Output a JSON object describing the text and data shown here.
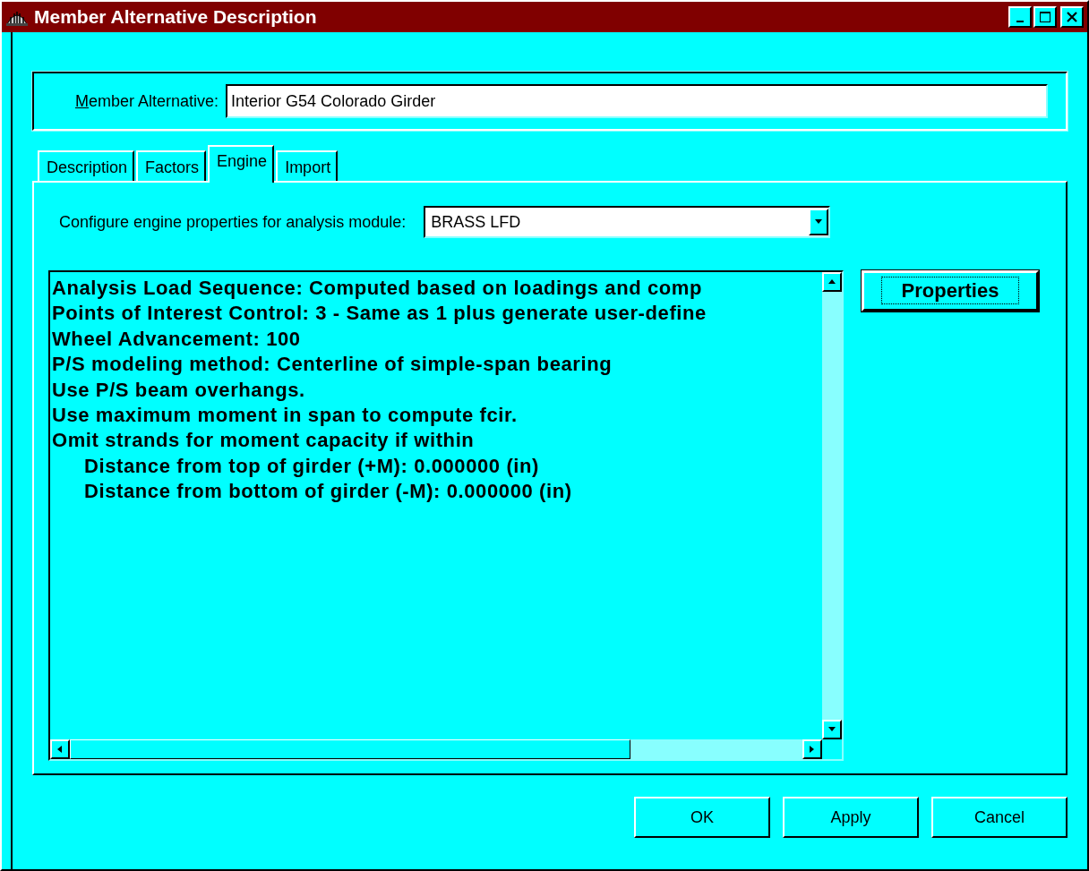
{
  "window": {
    "title": "Member Alternative Description"
  },
  "member_alternative": {
    "label": "Member Alternative:",
    "value": "Interior G54 Colorado Girder"
  },
  "tabs": [
    {
      "label": "Description",
      "selected": false
    },
    {
      "label": "Factors",
      "selected": false
    },
    {
      "label": "Engine",
      "selected": true
    },
    {
      "label": "Import",
      "selected": false
    }
  ],
  "module": {
    "label": "Configure engine properties for analysis module:",
    "value": "BRASS LFD"
  },
  "properties_list": [
    {
      "text": "Analysis Load Sequence: Computed based on loadings and comp"
    },
    {
      "text": "Points of Interest Control: 3 - Same as 1 plus generate user-define"
    },
    {
      "text": "Wheel Advancement: 100"
    },
    {
      "text": "P/S modeling method: Centerline of simple-span bearing"
    },
    {
      "text": "Use P/S beam overhangs."
    },
    {
      "text": "Use maximum moment in span to compute fcir."
    },
    {
      "text": "Omit strands for moment capacity if within",
      "children": [
        {
          "text": "Distance from top of girder (+M): 0.000000 (in)"
        },
        {
          "text": "Distance from bottom of girder (-M): 0.000000 (in)"
        }
      ]
    }
  ],
  "properties_button": "Properties",
  "buttons": [
    "OK",
    "Apply",
    "Cancel"
  ]
}
